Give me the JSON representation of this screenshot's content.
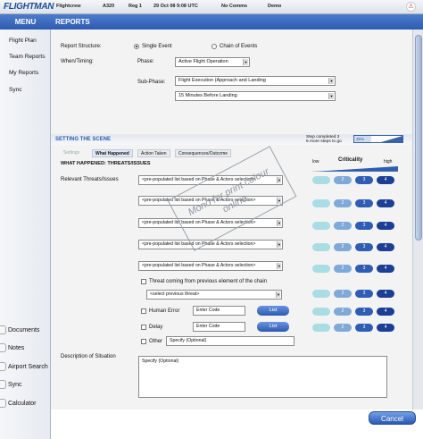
{
  "topbar": {
    "logo": "FLIGHTMAN",
    "crew": "Flightcrew",
    "aircraft": "A320",
    "reg": "Reg 1",
    "datetime": "29 Oct 08 9:08 UTC",
    "comms": "No Comms",
    "mode": "Demo",
    "alert_icon": "alert-icon"
  },
  "sidebar": {
    "title": "MENU",
    "items": [
      "Flight Plan",
      "Team Reports",
      "My Reports",
      "Sync"
    ],
    "bottom_items": [
      "Documents",
      "Notes",
      "Airport Search",
      "Sync",
      "Calculator"
    ]
  },
  "header": {
    "title": "REPORTS"
  },
  "form": {
    "report_structure_label": "Report Structure:",
    "opt_single": "Single Event",
    "opt_chain": "Chain of Events",
    "when_label": "When/Timing:",
    "phase_label": "Phase:",
    "phase_value": "Active Flight Operation",
    "subphase_label": "Sub-Phase:",
    "subphase_value": "Flight Execution (Approach and Landing",
    "subphase2_value": "15 Minutes Before Landing"
  },
  "scene": {
    "title": "SETTING THE SCENE",
    "step_completed": "Step completed 3",
    "steps_to_go": "6 more steps to go",
    "progress_label": "35%",
    "progress": 0.35,
    "tabs": [
      "Settings",
      "What Happened",
      "Action Taken",
      "Consequences/Outcome"
    ],
    "section_title": "WHAT HAPPENED: THREATS/ISSUES",
    "criticality_label": "Criticality",
    "low_label": "low",
    "high_label": "high",
    "relevant_label": "Relevant Threats/Issues",
    "threat_placeholder": "<pre-populated list based on Phase & Actors selection>",
    "threat_chain_label": "Threat coming from previous element of the chain",
    "select_previous": "<select previous threat>",
    "human_error_label": "Human Error",
    "delay_label": "Delay",
    "other_label": "Other",
    "enter_code": "Enter Code",
    "list_label": "List",
    "specify_optional": "Specify (Optional)",
    "description_label": "Description of Situation",
    "pill_levels": [
      "1",
      "2",
      "3",
      "4"
    ]
  },
  "watermark": "Mono for print colour online",
  "cancel_label": "Cancel"
}
